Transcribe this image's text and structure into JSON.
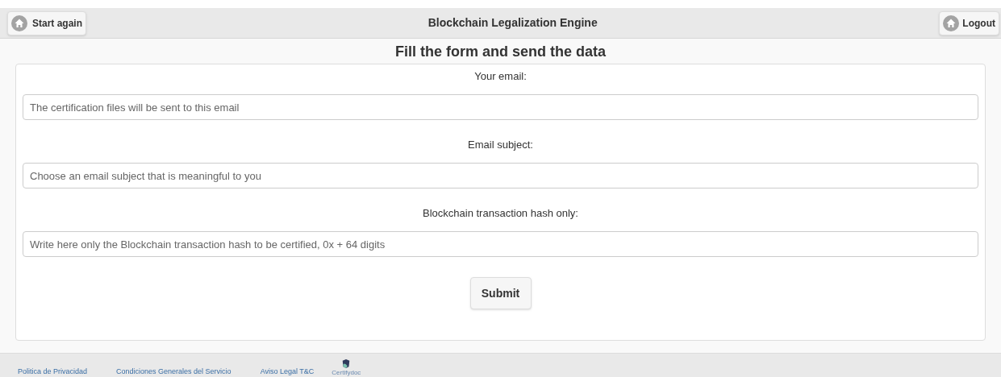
{
  "header": {
    "start_button": "Start again",
    "title": "Blockchain Legalization Engine",
    "logout_button": "Logout"
  },
  "form": {
    "heading": "Fill the form and send the data",
    "fields": [
      {
        "label": "Your email:",
        "placeholder": "The certification files will be sent to this email"
      },
      {
        "label": "Email subject:",
        "placeholder": "Choose an email subject that is meaningful to you"
      },
      {
        "label": "Blockchain transaction hash only:",
        "placeholder": "Write here only the Blockchain transaction hash to be certified, 0x + 64 digits"
      }
    ],
    "submit": "Submit"
  },
  "footer": {
    "links": [
      "Politica de Privacidad",
      "Condiciones Generales del Servicio",
      "Aviso Legal T&C"
    ],
    "logo_text": "Certifydoc"
  }
}
